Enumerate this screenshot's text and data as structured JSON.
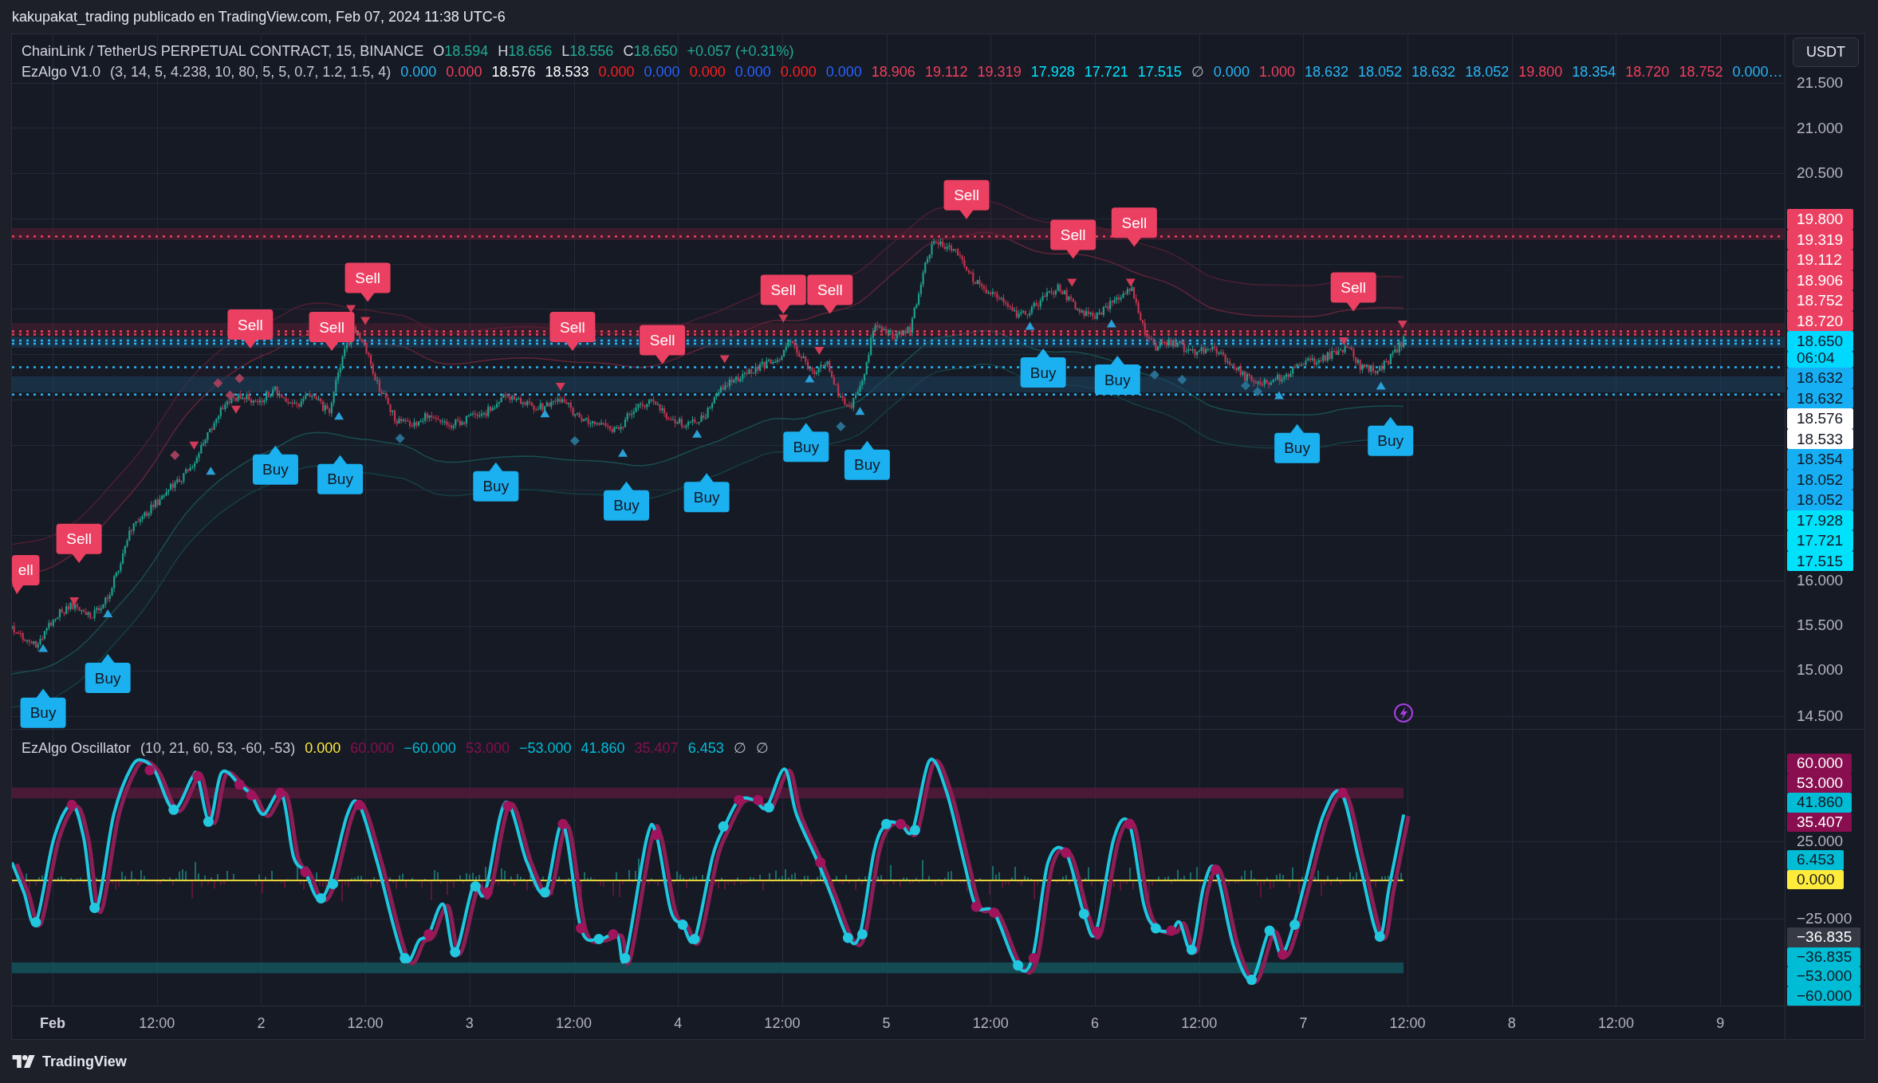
{
  "header": {
    "text": "kakupakat_trading publicado en TradingView.com, Feb 07, 2024 11:38 UTC-6"
  },
  "main_pane": {
    "legend": {
      "symbol": "ChainLink / TetherUS PERPETUAL CONTRACT, 15, BINANCE",
      "ohlc": [
        {
          "label": "O",
          "value": "18.594"
        },
        {
          "label": "H",
          "value": "18.656"
        },
        {
          "label": "L",
          "value": "18.556"
        },
        {
          "label": "C",
          "value": "18.650"
        }
      ],
      "change": "+0.057 (+0.31%)"
    },
    "indicator": {
      "name": "EzAlgo V1.0",
      "params": "(3, 14, 5, 4.238, 10, 80, 5, 5, 0.7, 1.2, 1.5, 4)",
      "values": [
        {
          "text": "0.000",
          "color": "#29b6f6"
        },
        {
          "text": "0.000",
          "color": "#f23f5d"
        },
        {
          "text": "18.576",
          "color": "#ffffff"
        },
        {
          "text": "18.533",
          "color": "#ffffff"
        },
        {
          "text": "0.000",
          "color": "#ff1f1f"
        },
        {
          "text": "0.000",
          "color": "#2962ff"
        },
        {
          "text": "0.000",
          "color": "#ff1f1f"
        },
        {
          "text": "0.000",
          "color": "#2962ff"
        },
        {
          "text": "0.000",
          "color": "#ff1f1f"
        },
        {
          "text": "0.000",
          "color": "#2962ff"
        },
        {
          "text": "18.906",
          "color": "#f23f5d"
        },
        {
          "text": "19.112",
          "color": "#f23f5d"
        },
        {
          "text": "19.319",
          "color": "#f23f5d"
        },
        {
          "text": "17.928",
          "color": "#00e5ff"
        },
        {
          "text": "17.721",
          "color": "#00e5ff"
        },
        {
          "text": "17.515",
          "color": "#00e5ff"
        },
        {
          "text": "∅",
          "color": "#b2b5be"
        },
        {
          "text": "0.000",
          "color": "#29b6f6"
        },
        {
          "text": "1.000",
          "color": "#f23f5d"
        },
        {
          "text": "18.632",
          "color": "#29b6f6"
        },
        {
          "text": "18.052",
          "color": "#29b6f6"
        },
        {
          "text": "18.632",
          "color": "#29b6f6"
        },
        {
          "text": "18.052",
          "color": "#29b6f6"
        },
        {
          "text": "19.800",
          "color": "#f23f5d"
        },
        {
          "text": "18.354",
          "color": "#29b6f6"
        },
        {
          "text": "18.720",
          "color": "#f23f5d"
        },
        {
          "text": "18.752",
          "color": "#f23f5d"
        },
        {
          "text": "0.000…",
          "color": "#29b6f6"
        }
      ]
    },
    "signals": [
      {
        "kind": "sell",
        "text": "ell"
      },
      {
        "kind": "buy",
        "text": "Buy"
      },
      {
        "kind": "sell",
        "text": "Sell"
      },
      {
        "kind": "buy",
        "text": "Buy"
      },
      {
        "kind": "sell",
        "text": "Sell"
      },
      {
        "kind": "buy",
        "text": "Buy"
      },
      {
        "kind": "sell",
        "text": "Sell"
      },
      {
        "kind": "buy",
        "text": "Buy"
      },
      {
        "kind": "sell",
        "text": "Sell"
      },
      {
        "kind": "buy",
        "text": "Buy"
      },
      {
        "kind": "sell",
        "text": "Sell"
      },
      {
        "kind": "buy",
        "text": "Buy"
      },
      {
        "kind": "sell",
        "text": "Sell"
      },
      {
        "kind": "buy",
        "text": "Buy"
      },
      {
        "kind": "sell",
        "text": "Sell"
      },
      {
        "kind": "buy",
        "text": "Buy"
      },
      {
        "kind": "sell",
        "text": "Sell"
      },
      {
        "kind": "buy",
        "text": "Buy"
      },
      {
        "kind": "sell",
        "text": "Sell"
      },
      {
        "kind": "buy",
        "text": "Buy"
      },
      {
        "kind": "sell",
        "text": "Sell"
      },
      {
        "kind": "buy",
        "text": "Buy"
      },
      {
        "kind": "sell",
        "text": "Sell"
      },
      {
        "kind": "buy",
        "text": "Buy"
      },
      {
        "kind": "sell",
        "text": "Sell"
      },
      {
        "kind": "buy",
        "text": "Buy"
      }
    ]
  },
  "price_axis": {
    "currency": "USDT",
    "ticks": [
      "21.500",
      "21.000",
      "20.500",
      "16.000",
      "15.500",
      "15.000",
      "14.500"
    ],
    "tags": [
      {
        "text": "19.800",
        "color": "#ec4062"
      },
      {
        "text": "19.319",
        "color": "#ec4062"
      },
      {
        "text": "19.112",
        "color": "#ec4062"
      },
      {
        "text": "18.906",
        "color": "#ec4062"
      },
      {
        "text": "18.752",
        "color": "#ec4062"
      },
      {
        "text": "18.720",
        "color": "#ec4062"
      },
      {
        "text": "18.650",
        "countdown": "06:04",
        "color": "#00d9ff"
      },
      {
        "text": "18.632",
        "color": "#17aff4"
      },
      {
        "text": "18.632",
        "color": "#17aff4"
      },
      {
        "text": "18.576",
        "color": "#ffffff"
      },
      {
        "text": "18.533",
        "color": "#ffffff"
      },
      {
        "text": "18.354",
        "color": "#17aff4"
      },
      {
        "text": "18.052",
        "color": "#17aff4"
      },
      {
        "text": "18.052",
        "color": "#17aff4"
      },
      {
        "text": "17.928",
        "color": "#00e1fb"
      },
      {
        "text": "17.721",
        "color": "#00e1fb"
      },
      {
        "text": "17.515",
        "color": "#00e1fb"
      }
    ]
  },
  "oscillator_pane": {
    "legend": {
      "name": "EzAlgo Oscillator",
      "params": "(10, 21, 60, 53, -60, -53)",
      "values": [
        {
          "text": "0.000",
          "color": "#ffeb3b"
        },
        {
          "text": "60.000",
          "color": "#880e4f"
        },
        {
          "text": "−60.000",
          "color": "#00bcd4"
        },
        {
          "text": "53.000",
          "color": "#880e4f"
        },
        {
          "text": "−53.000",
          "color": "#00bcd4"
        },
        {
          "text": "41.860",
          "color": "#00bcd4"
        },
        {
          "text": "35.407",
          "color": "#880e4f"
        },
        {
          "text": "6.453",
          "color": "#00bcd4"
        },
        {
          "text": "∅",
          "color": "#b2b5be"
        },
        {
          "text": "∅",
          "color": "#b2b5be"
        }
      ]
    }
  },
  "oscillator_axis": {
    "ticks": [
      "25.000",
      "−25.000"
    ],
    "tags": [
      {
        "text": "60.000",
        "color": "#880e4f"
      },
      {
        "text": "53.000",
        "color": "#880e4f"
      },
      {
        "text": "41.860",
        "color": "#00bcd4"
      },
      {
        "text": "35.407",
        "color": "#880e4f"
      },
      {
        "text": "6.453",
        "color": "#00bcd4"
      },
      {
        "text": "0.000",
        "color": "#ffeb3b"
      },
      {
        "text": "−36.835",
        "color": "#363a45"
      },
      {
        "text": "−36.835",
        "color": "#00bcd4"
      },
      {
        "text": "−53.000",
        "color": "#00bcd4"
      },
      {
        "text": "−60.000",
        "color": "#00bcd4"
      }
    ]
  },
  "time_axis": {
    "labels": [
      {
        "text": "Feb",
        "kind": "month"
      },
      {
        "text": "12:00",
        "kind": "time"
      },
      {
        "text": "2",
        "kind": "day"
      },
      {
        "text": "12:00",
        "kind": "time"
      },
      {
        "text": "3",
        "kind": "day"
      },
      {
        "text": "12:00",
        "kind": "time"
      },
      {
        "text": "4",
        "kind": "day"
      },
      {
        "text": "12:00",
        "kind": "time"
      },
      {
        "text": "5",
        "kind": "day"
      },
      {
        "text": "12:00",
        "kind": "time"
      },
      {
        "text": "6",
        "kind": "day"
      },
      {
        "text": "12:00",
        "kind": "time"
      },
      {
        "text": "7",
        "kind": "day"
      },
      {
        "text": "12:00",
        "kind": "time"
      },
      {
        "text": "8",
        "kind": "day"
      },
      {
        "text": "12:00",
        "kind": "time"
      },
      {
        "text": "9",
        "kind": "day"
      }
    ]
  },
  "footer": {
    "brand": "TradingView"
  }
}
